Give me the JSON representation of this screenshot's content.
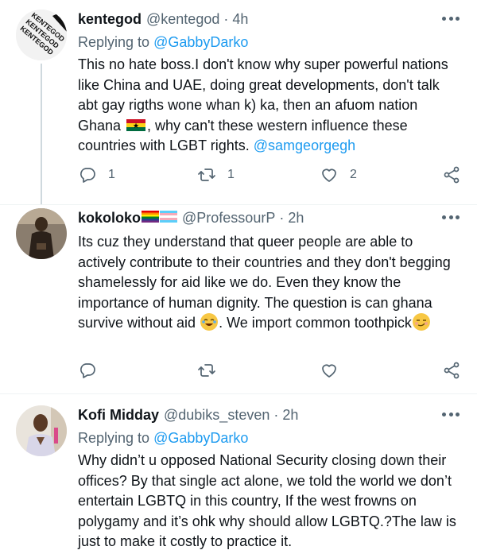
{
  "tweets": [
    {
      "name": "kentegod",
      "handle": "@kentegod",
      "time": "4h",
      "avatar_text": "KENTEGOD",
      "reply_prefix": "Replying to ",
      "reply_mention": "@GabbyDarko",
      "body_part1": "This no hate boss.I don't know why super powerful nations like China and UAE, doing great developments, don't talk abt gay rigths wone whan k) ka, then an afuom nation Ghana ",
      "body_part2": ", why can't these western influence these countries with LGBT rights. ",
      "body_mention": "@samgeorgegh",
      "reply_count": "1",
      "retweet_count": "1",
      "like_count": "2"
    },
    {
      "name": "kokoloko",
      "handle": "@ProfessourP",
      "time": "2h",
      "body_part1": "Its cuz they understand that queer people are able to actively contribute to their countries and they don't begging shamelessly  for aid like we do. Even they know the importance of human dignity. The question is can ghana survive without aid ",
      "body_part2": ". We import common toothpick"
    },
    {
      "name": "Kofi Midday",
      "handle": "@dubiks_steven",
      "time": "2h",
      "reply_prefix": "Replying to ",
      "reply_mention": "@GabbyDarko",
      "body": "Why didn’t u opposed National Security closing down their offices?  By that single act alone, we told the world we don’t entertain LGBTQ in this country, If the west frowns on polygamy and it’s ohk why should allow LGBTQ.?The law is just to make it costly to practice it."
    }
  ],
  "separator": "·",
  "icons": {
    "reply": "reply-icon",
    "retweet": "retweet-icon",
    "like": "heart-icon",
    "share": "share-icon",
    "more": "more-icon"
  },
  "colors": {
    "link": "#1d9bf0",
    "secondary_text": "#536471",
    "divider": "#eff3f4"
  }
}
